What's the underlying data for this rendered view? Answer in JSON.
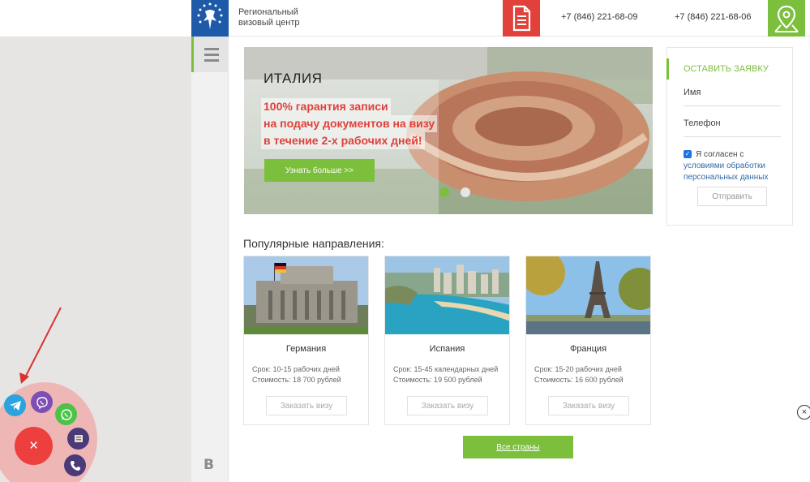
{
  "header": {
    "brand_line1": "Региональный",
    "brand_line2": "визовый центр",
    "phone1": "+7 (846) 221-68-09",
    "phone2": "+7 (846) 221-68-06"
  },
  "sidebar": {
    "bottom_letter": "B"
  },
  "slider": {
    "title": "ИТАЛИЯ",
    "promo_line1": "100% гарантия записи",
    "promo_line2": "на подачу документов на визу",
    "promo_line3": "в течение 2-х рабочих дней!",
    "button": "Узнать больше >>"
  },
  "form": {
    "title": "ОСТАВИТЬ ЗАЯВКУ",
    "name_placeholder": "Имя",
    "phone_placeholder": "Телефон",
    "consent_text": "Я согласен с",
    "consent_link": "условиями обработки персональных данных",
    "submit": "Отправить"
  },
  "destinations": {
    "title": "Популярные направления:",
    "cards": [
      {
        "name": "Германия",
        "term": "Срок: 10-15 рабочих дней",
        "cost": "Стоимость: 18 700 рублей",
        "button": "Заказать визу"
      },
      {
        "name": "Испания",
        "term": "Срок: 15-45 календарных дней",
        "cost": "Стоимость: 19 500 рублей",
        "button": "Заказать визу"
      },
      {
        "name": "Франция",
        "term": "Срок: 15-20 рабочих дней",
        "cost": "Стоимость: 16 600 рублей",
        "button": "Заказать визу"
      }
    ],
    "all_button": "Все страны"
  },
  "widget": {
    "close_symbol": "×",
    "side_close_symbol": "×"
  },
  "colors": {
    "green": "#7cbf3c",
    "red": "#e2403a",
    "blue_logo": "#1e5aa8",
    "widget_red": "#ee3f3f",
    "bubble_pink": "#efb6b6"
  },
  "icons": [
    "menu-icon",
    "logo-icon",
    "document-icon",
    "map-pin-icon",
    "telegram-icon",
    "viber-icon",
    "whatsapp-icon",
    "message-icon",
    "phone-icon",
    "close-icon"
  ]
}
